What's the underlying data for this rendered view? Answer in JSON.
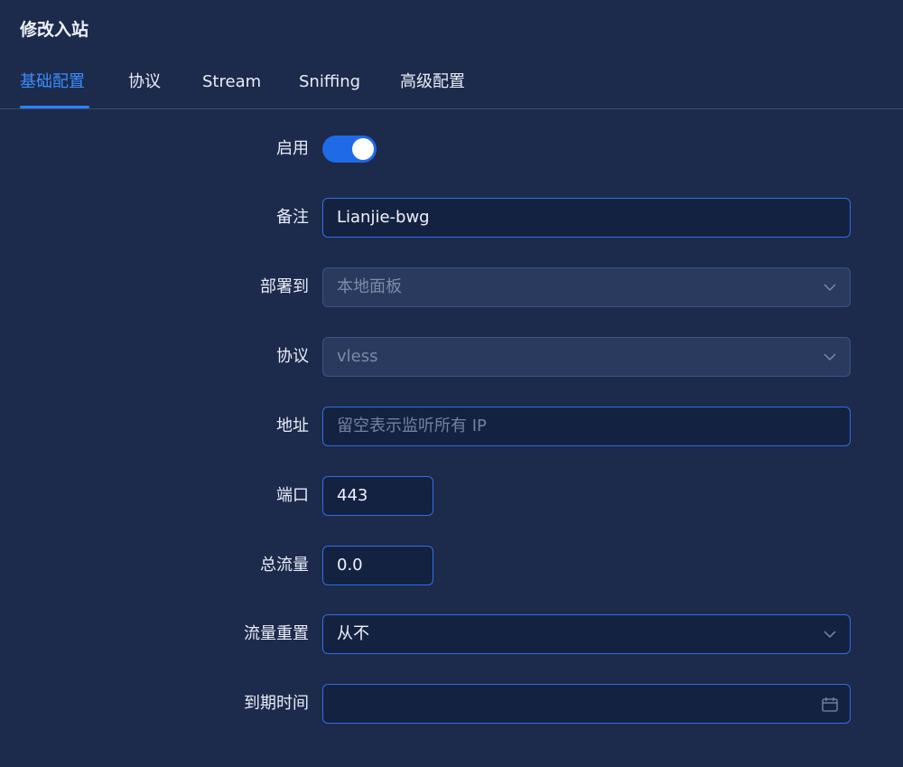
{
  "dialog": {
    "title": "修改入站"
  },
  "tabs": [
    {
      "label": "基础配置",
      "active": true
    },
    {
      "label": "协议",
      "active": false
    },
    {
      "label": "Stream",
      "active": false
    },
    {
      "label": "Sniffing",
      "active": false
    },
    {
      "label": "高级配置",
      "active": false
    }
  ],
  "form": {
    "enable": {
      "label": "启用",
      "value": true
    },
    "remark": {
      "label": "备注",
      "value": "Lianjie-bwg"
    },
    "deploy_to": {
      "label": "部署到",
      "value": "本地面板",
      "disabled": true
    },
    "protocol": {
      "label": "协议",
      "value": "vless",
      "disabled": true
    },
    "address": {
      "label": "地址",
      "value": "",
      "placeholder": "留空表示监听所有 IP"
    },
    "port": {
      "label": "端口",
      "value": "443"
    },
    "total_traffic": {
      "label": "总流量",
      "value": "0.0"
    },
    "traffic_reset": {
      "label": "流量重置",
      "value": "从不"
    },
    "expiry_time": {
      "label": "到期时间",
      "value": ""
    }
  },
  "colors": {
    "background": "#1c2a4b",
    "accent": "#2f80ff",
    "input_bg": "#142242",
    "disabled_bg": "#2a3a5e"
  },
  "icons": {
    "select_arrow": "chevron-down-icon",
    "date_picker": "calendar-icon"
  }
}
